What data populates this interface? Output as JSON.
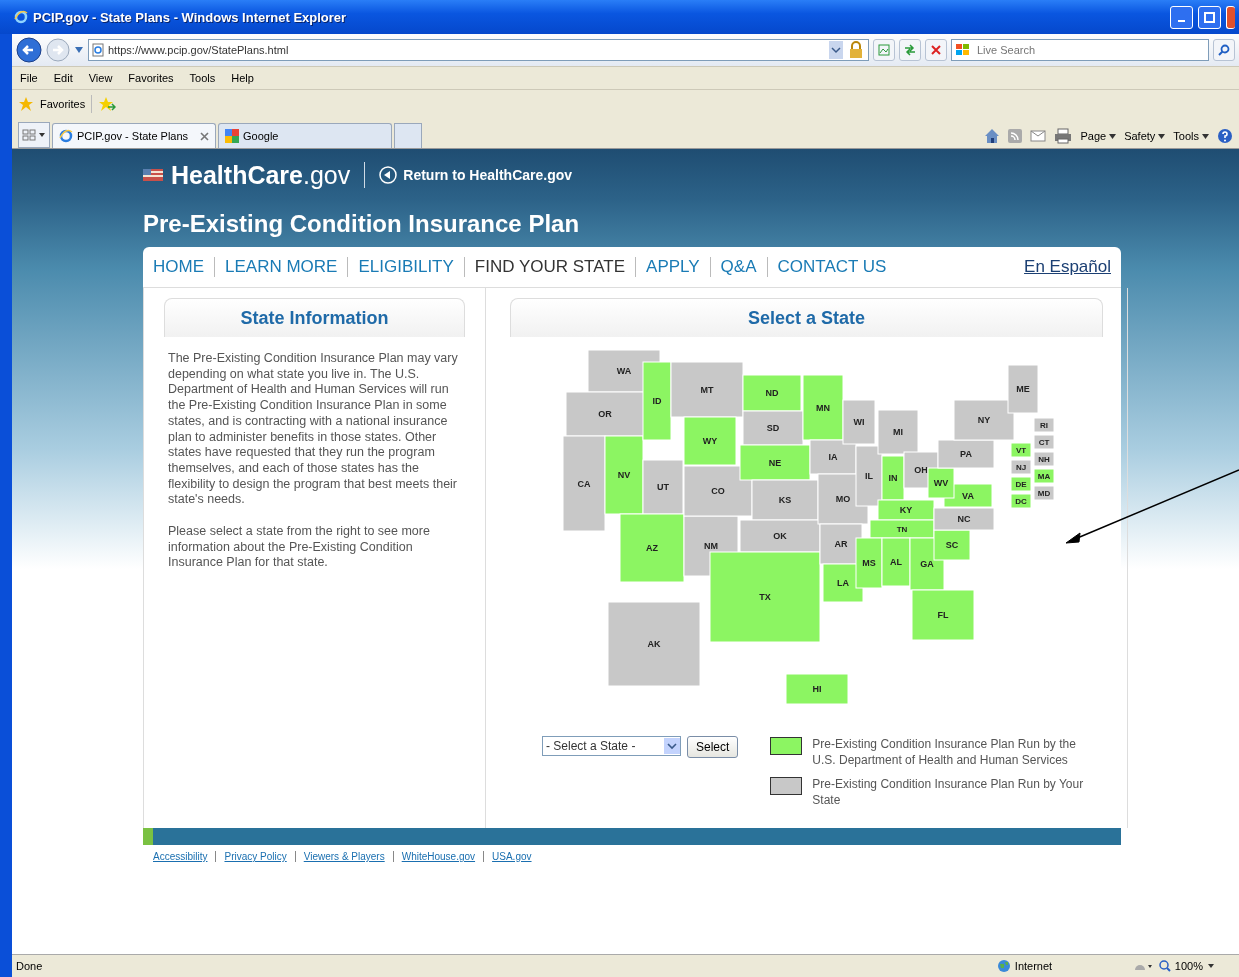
{
  "window": {
    "title": "PCIP.gov - State Plans - Windows Internet Explorer"
  },
  "address_bar": {
    "url": "https://www.pcip.gov/StatePlans.html"
  },
  "search": {
    "placeholder": "Live Search"
  },
  "menu": [
    "File",
    "Edit",
    "View",
    "Favorites",
    "Tools",
    "Help"
  ],
  "favorites": {
    "label": "Favorites"
  },
  "tabs": [
    {
      "label": "PCIP.gov - State Plans",
      "selected": true
    },
    {
      "label": "Google",
      "selected": false
    }
  ],
  "command_bar": [
    "Page",
    "Safety",
    "Tools"
  ],
  "site": {
    "logo": "**HealthCare**.gov",
    "return_link": "Return to HealthCare.gov",
    "title": "Pre-Existing Condition Insurance Plan"
  },
  "nav": [
    {
      "label": "HOME",
      "selected": false
    },
    {
      "label": "LEARN MORE",
      "selected": false
    },
    {
      "label": "ELIGIBILITY",
      "selected": false
    },
    {
      "label": "FIND YOUR STATE",
      "selected": true
    },
    {
      "label": "APPLY",
      "selected": false
    },
    {
      "label": "Q&A",
      "selected": false
    },
    {
      "label": "CONTACT US",
      "selected": false
    }
  ],
  "language_link": "En Español",
  "info_panel": {
    "heading": "State Information",
    "paragraphs": [
      "The Pre-Existing Condition Insurance Plan may vary depending on what state you live in. The U.S. Department of Health and Human Services will run the Pre-Existing Condition Insurance Plan in some states, and is contracting with a national insurance plan to administer benefits in those states. Other states have requested that they run the program themselves, and each of those states has the flexibility to design the program that best meets their state's needs.",
      "Please select a state from the right to see more information about the Pre-Existing Condition Insurance Plan for that state."
    ]
  },
  "map_panel": {
    "heading": "Select a State",
    "states": [
      {
        "label": "WA",
        "color": "#c8c8c8"
      },
      {
        "label": "OR",
        "color": "#c8c8c8"
      },
      {
        "label": "CA",
        "color": "#c8c8c8"
      },
      {
        "label": "NV",
        "color": "#8cf562"
      },
      {
        "label": "ID",
        "color": "#8cf562"
      },
      {
        "label": "MT",
        "color": "#c8c8c8"
      },
      {
        "label": "WY",
        "color": "#8cf562"
      },
      {
        "label": "UT",
        "color": "#c8c8c8"
      },
      {
        "label": "AZ",
        "color": "#8cf562"
      },
      {
        "label": "NM",
        "color": "#c8c8c8"
      },
      {
        "label": "CO",
        "color": "#c8c8c8"
      },
      {
        "label": "ND",
        "color": "#8cf562"
      },
      {
        "label": "SD",
        "color": "#c8c8c8"
      },
      {
        "label": "NE",
        "color": "#8cf562"
      },
      {
        "label": "KS",
        "color": "#c8c8c8"
      },
      {
        "label": "OK",
        "color": "#c8c8c8"
      },
      {
        "label": "TX",
        "color": "#8cf562"
      },
      {
        "label": "MN",
        "color": "#8cf562"
      },
      {
        "label": "IA",
        "color": "#c8c8c8"
      },
      {
        "label": "MO",
        "color": "#c8c8c8"
      },
      {
        "label": "AR",
        "color": "#c8c8c8"
      },
      {
        "label": "LA",
        "color": "#8cf562"
      },
      {
        "label": "WI",
        "color": "#c8c8c8"
      },
      {
        "label": "IL",
        "color": "#c8c8c8"
      },
      {
        "label": "MI",
        "color": "#c8c8c8"
      },
      {
        "label": "IN",
        "color": "#8cf562"
      },
      {
        "label": "OH",
        "color": "#c8c8c8"
      },
      {
        "label": "KY",
        "color": "#8cf562"
      },
      {
        "label": "TN",
        "color": "#8cf562"
      },
      {
        "label": "MS",
        "color": "#8cf562"
      },
      {
        "label": "AL",
        "color": "#8cf562"
      },
      {
        "label": "GA",
        "color": "#8cf562"
      },
      {
        "label": "FL",
        "color": "#8cf562"
      },
      {
        "label": "SC",
        "color": "#8cf562"
      },
      {
        "label": "VA",
        "color": "#8cf562"
      },
      {
        "label": "NC",
        "color": "#c8c8c8"
      },
      {
        "label": "WV",
        "color": "#8cf562"
      },
      {
        "label": "PA",
        "color": "#c8c8c8"
      },
      {
        "label": "NY",
        "color": "#c8c8c8"
      },
      {
        "label": "ME",
        "color": "#c8c8c8"
      },
      {
        "label": "AK",
        "color": "#c8c8c8"
      },
      {
        "label": "HI",
        "color": "#8cf562"
      },
      {
        "label": "RI",
        "color": "#c8c8c8"
      },
      {
        "label": "CT",
        "color": "#c8c8c8"
      },
      {
        "label": "VT",
        "color": "#8cf562"
      },
      {
        "label": "NH",
        "color": "#c8c8c8"
      },
      {
        "label": "NJ",
        "color": "#c8c8c8"
      },
      {
        "label": "MA",
        "color": "#8cf562"
      },
      {
        "label": "DE",
        "color": "#8cf562"
      },
      {
        "label": "MD",
        "color": "#c8c8c8"
      },
      {
        "label": "DC",
        "color": "#8cf562"
      }
    ],
    "dropdown": {
      "value": "- Select a State -"
    },
    "select_button": "Select",
    "legend": [
      {
        "color": "#8cf562",
        "label": "Pre-Existing Condition Insurance Plan Run by the U.S. Department of Health and Human Services"
      },
      {
        "color": "#c8c8c8",
        "label": "Pre-Existing Condition Insurance Plan Run by Your State"
      }
    ]
  },
  "footer_links": [
    "Accessibility",
    "Privacy Policy",
    "Viewers & Players",
    "WhiteHouse.gov",
    "USA.gov"
  ],
  "status_bar": {
    "text": "Done",
    "zone": "Internet",
    "zoom": "100%"
  }
}
